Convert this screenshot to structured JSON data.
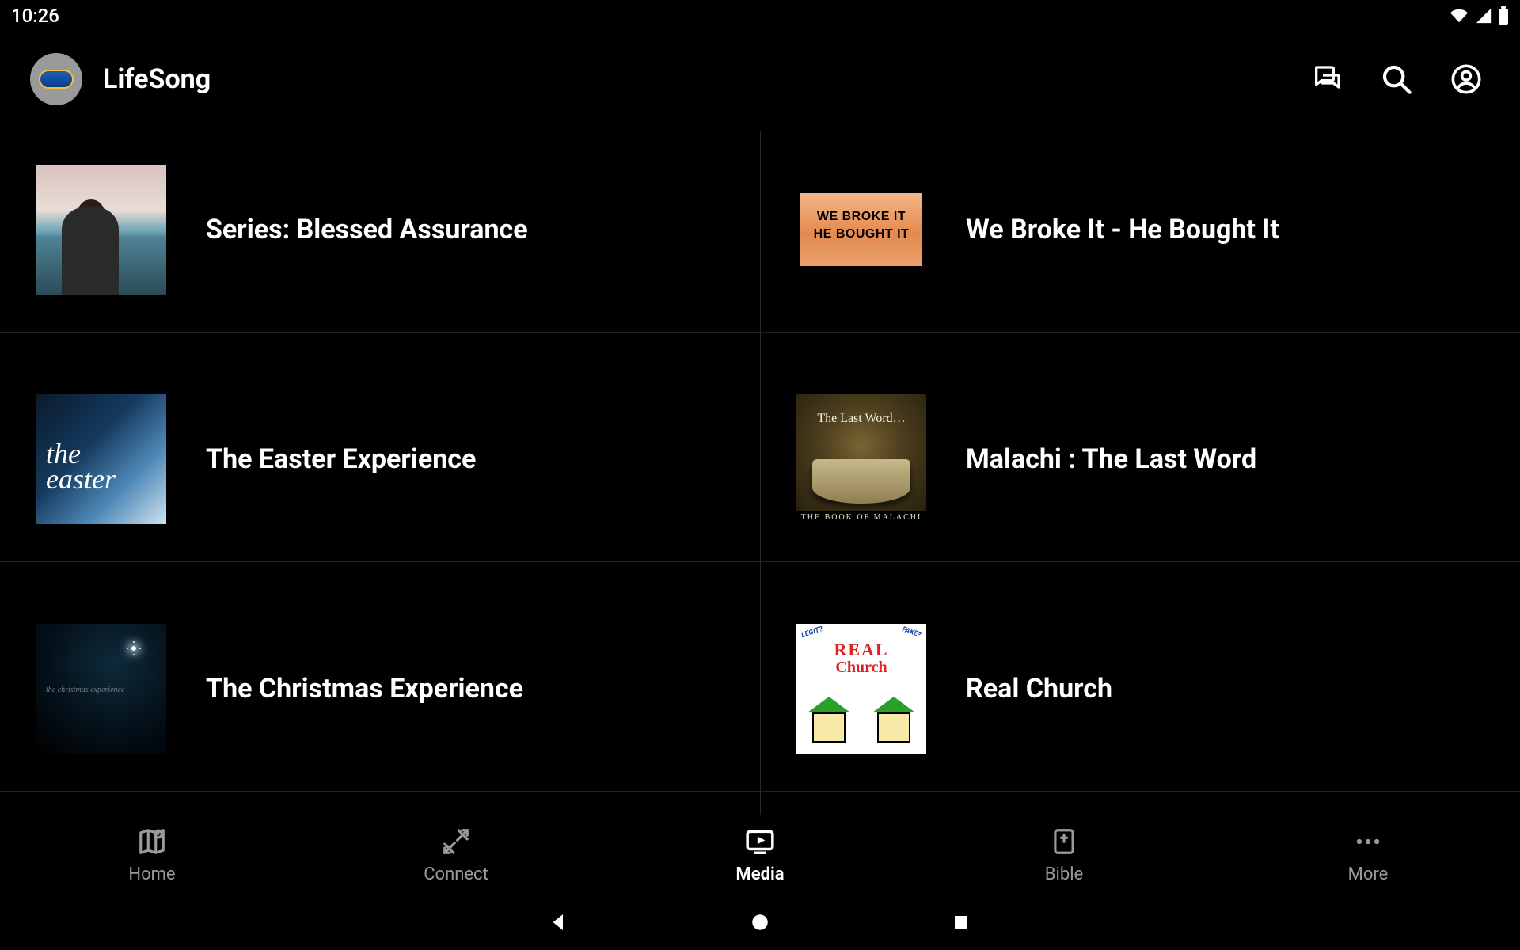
{
  "status": {
    "time": "10:26"
  },
  "header": {
    "title": "LifeSong"
  },
  "media": [
    {
      "title": "Series: Blessed Assurance",
      "thumbKind": "blessed"
    },
    {
      "title": "We Broke It - He Bought It",
      "thumbKind": "webroke",
      "thumbText": {
        "l1": "WE BROKE IT",
        "l2": "HE BOUGHT IT"
      }
    },
    {
      "title": "The Easter Experience",
      "thumbKind": "easter",
      "thumbText": {
        "script": "the\neaster"
      }
    },
    {
      "title": "Malachi : The Last Word",
      "thumbKind": "malachi",
      "thumbText": {
        "top": "The Last Word…",
        "bar": "THE BOOK OF MALACHI"
      }
    },
    {
      "title": "The Christmas Experience",
      "thumbKind": "christmas"
    },
    {
      "title": "Real Church",
      "thumbKind": "real",
      "thumbText": {
        "l1": "REAL",
        "l2": "Church",
        "tagL": "LEGIT?",
        "tagR": "FAKE?"
      }
    }
  ],
  "tabs": [
    {
      "id": "home",
      "label": "Home",
      "active": false
    },
    {
      "id": "connect",
      "label": "Connect",
      "active": false
    },
    {
      "id": "media",
      "label": "Media",
      "active": true
    },
    {
      "id": "bible",
      "label": "Bible",
      "active": false
    },
    {
      "id": "more",
      "label": "More",
      "active": false
    }
  ]
}
